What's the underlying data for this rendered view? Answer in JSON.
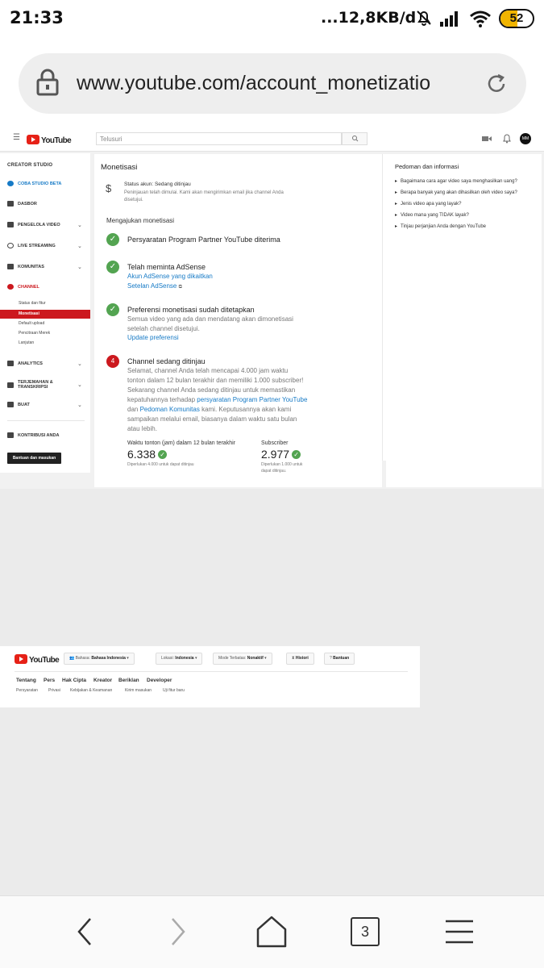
{
  "status_bar": {
    "time": "21:33",
    "network_speed": "...12,8KB/d",
    "battery": "52",
    "battery_fraction": 0.52
  },
  "browser": {
    "url": "www.youtube.com/account_monetizatio",
    "tab_count": "3"
  },
  "yt_header": {
    "search_placeholder": "Telusuri",
    "avatar_initials": "MM"
  },
  "sidebar": {
    "title": "CREATOR STUDIO",
    "items": [
      {
        "label": "COBA STUDIO BETA"
      },
      {
        "label": "DASBOR"
      },
      {
        "label": "PENGELOLA VIDEO"
      },
      {
        "label": "LIVE STREAMING"
      },
      {
        "label": "KOMUNITAS"
      },
      {
        "label": "CHANNEL"
      },
      {
        "label": "ANALYTICS"
      },
      {
        "label": "TERJEMAHAN &"
      },
      {
        "label": "BUAT"
      },
      {
        "label": "KONTRIBUSI ANDA"
      }
    ],
    "item7_line2": "TRANSKRIPSI",
    "channel_sub": [
      "Status dan fitur",
      "Monetisasi",
      "Default upload",
      "Pencitraan Merek",
      "Lanjutan"
    ],
    "feedback_button": "Bantuan dan masukan"
  },
  "main": {
    "title": "Monetisasi",
    "account_status": "Status akun: Sedang ditinjau",
    "account_note_1": "Peninjauan telah dimulai. Kami akan mengirimkan email jika channel Anda",
    "account_note_2": "disetujui.",
    "section_title": "Mengajukan monetisasi",
    "step1_title": "Persyaratan Program Partner YouTube diterima",
    "step2_title": "Telah meminta AdSense",
    "step2_link1": "Akun AdSense yang dikaitkan",
    "step2_link2": "Setelan AdSense",
    "step3_title": "Preferensi monetisasi sudah ditetapkan",
    "step3_text_1": "Semua video yang ada dan mendatang akan dimonetisasi",
    "step3_text_2": "setelah channel disetujui.",
    "step3_link": "Update preferensi",
    "step4_number": "4",
    "step4_title": "Channel sedang ditinjau",
    "step4_line1": "Selamat, channel Anda telah mencapai 4.000 jam waktu",
    "step4_line2": "tonton dalam 12 bulan terakhir dan memiliki 1.000 subscriber!",
    "step4_line3": "Sekarang channel Anda sedang ditinjau untuk memastikan",
    "step4_line4_pre": "kepatuhannya terhadap ",
    "step4_line4_link": "persyaratan Program Partner YouTube",
    "step4_line5_pre": "dan ",
    "step4_line5_link": "Pedoman Komunitas",
    "step4_line5_post": " kami. Keputusannya akan kami",
    "step4_line6": "sampaikan melalui email, biasanya dalam waktu satu bulan",
    "step4_line7": "atau lebih.",
    "watch_label": "Waktu tonton (jam) dalam 12 bulan terakhir",
    "watch_value": "6.338",
    "watch_req": "Diperlukan 4.000 untuk dapat ditinjau",
    "sub_label": "Subscriber",
    "sub_value": "2.977",
    "sub_req_1": "Diperlukan 1.000 untuk",
    "sub_req_2": "dapat ditinjau."
  },
  "guide": {
    "title": "Pedoman dan informasi",
    "items": [
      "Bagaimana cara agar video saya menghasilkan uang?",
      "Berapa banyak yang akan dihasilkan oleh video saya?",
      "Jenis video apa yang layak?",
      "Video mana yang TIDAK layak?",
      "Tinjau perjanjian Anda dengan YouTube"
    ]
  },
  "footer": {
    "language_label": "Bahasa:",
    "language_value": "Bahasa Indonesia",
    "location_label": "Lokasi:",
    "location_value": "Indonesia",
    "restricted_label": "Mode Terbatas:",
    "restricted_value": "Nonaktif",
    "history": "Histori",
    "help": "Bantuan",
    "links": [
      "Tentang",
      "Pers",
      "Hak Cipta",
      "Kreator",
      "Beriklan",
      "Developer"
    ],
    "links2": [
      "Persyaratan",
      "Privasi",
      "Kebijakan & Keamanan",
      "Kirim masukan",
      "Uji fitur baru"
    ]
  }
}
